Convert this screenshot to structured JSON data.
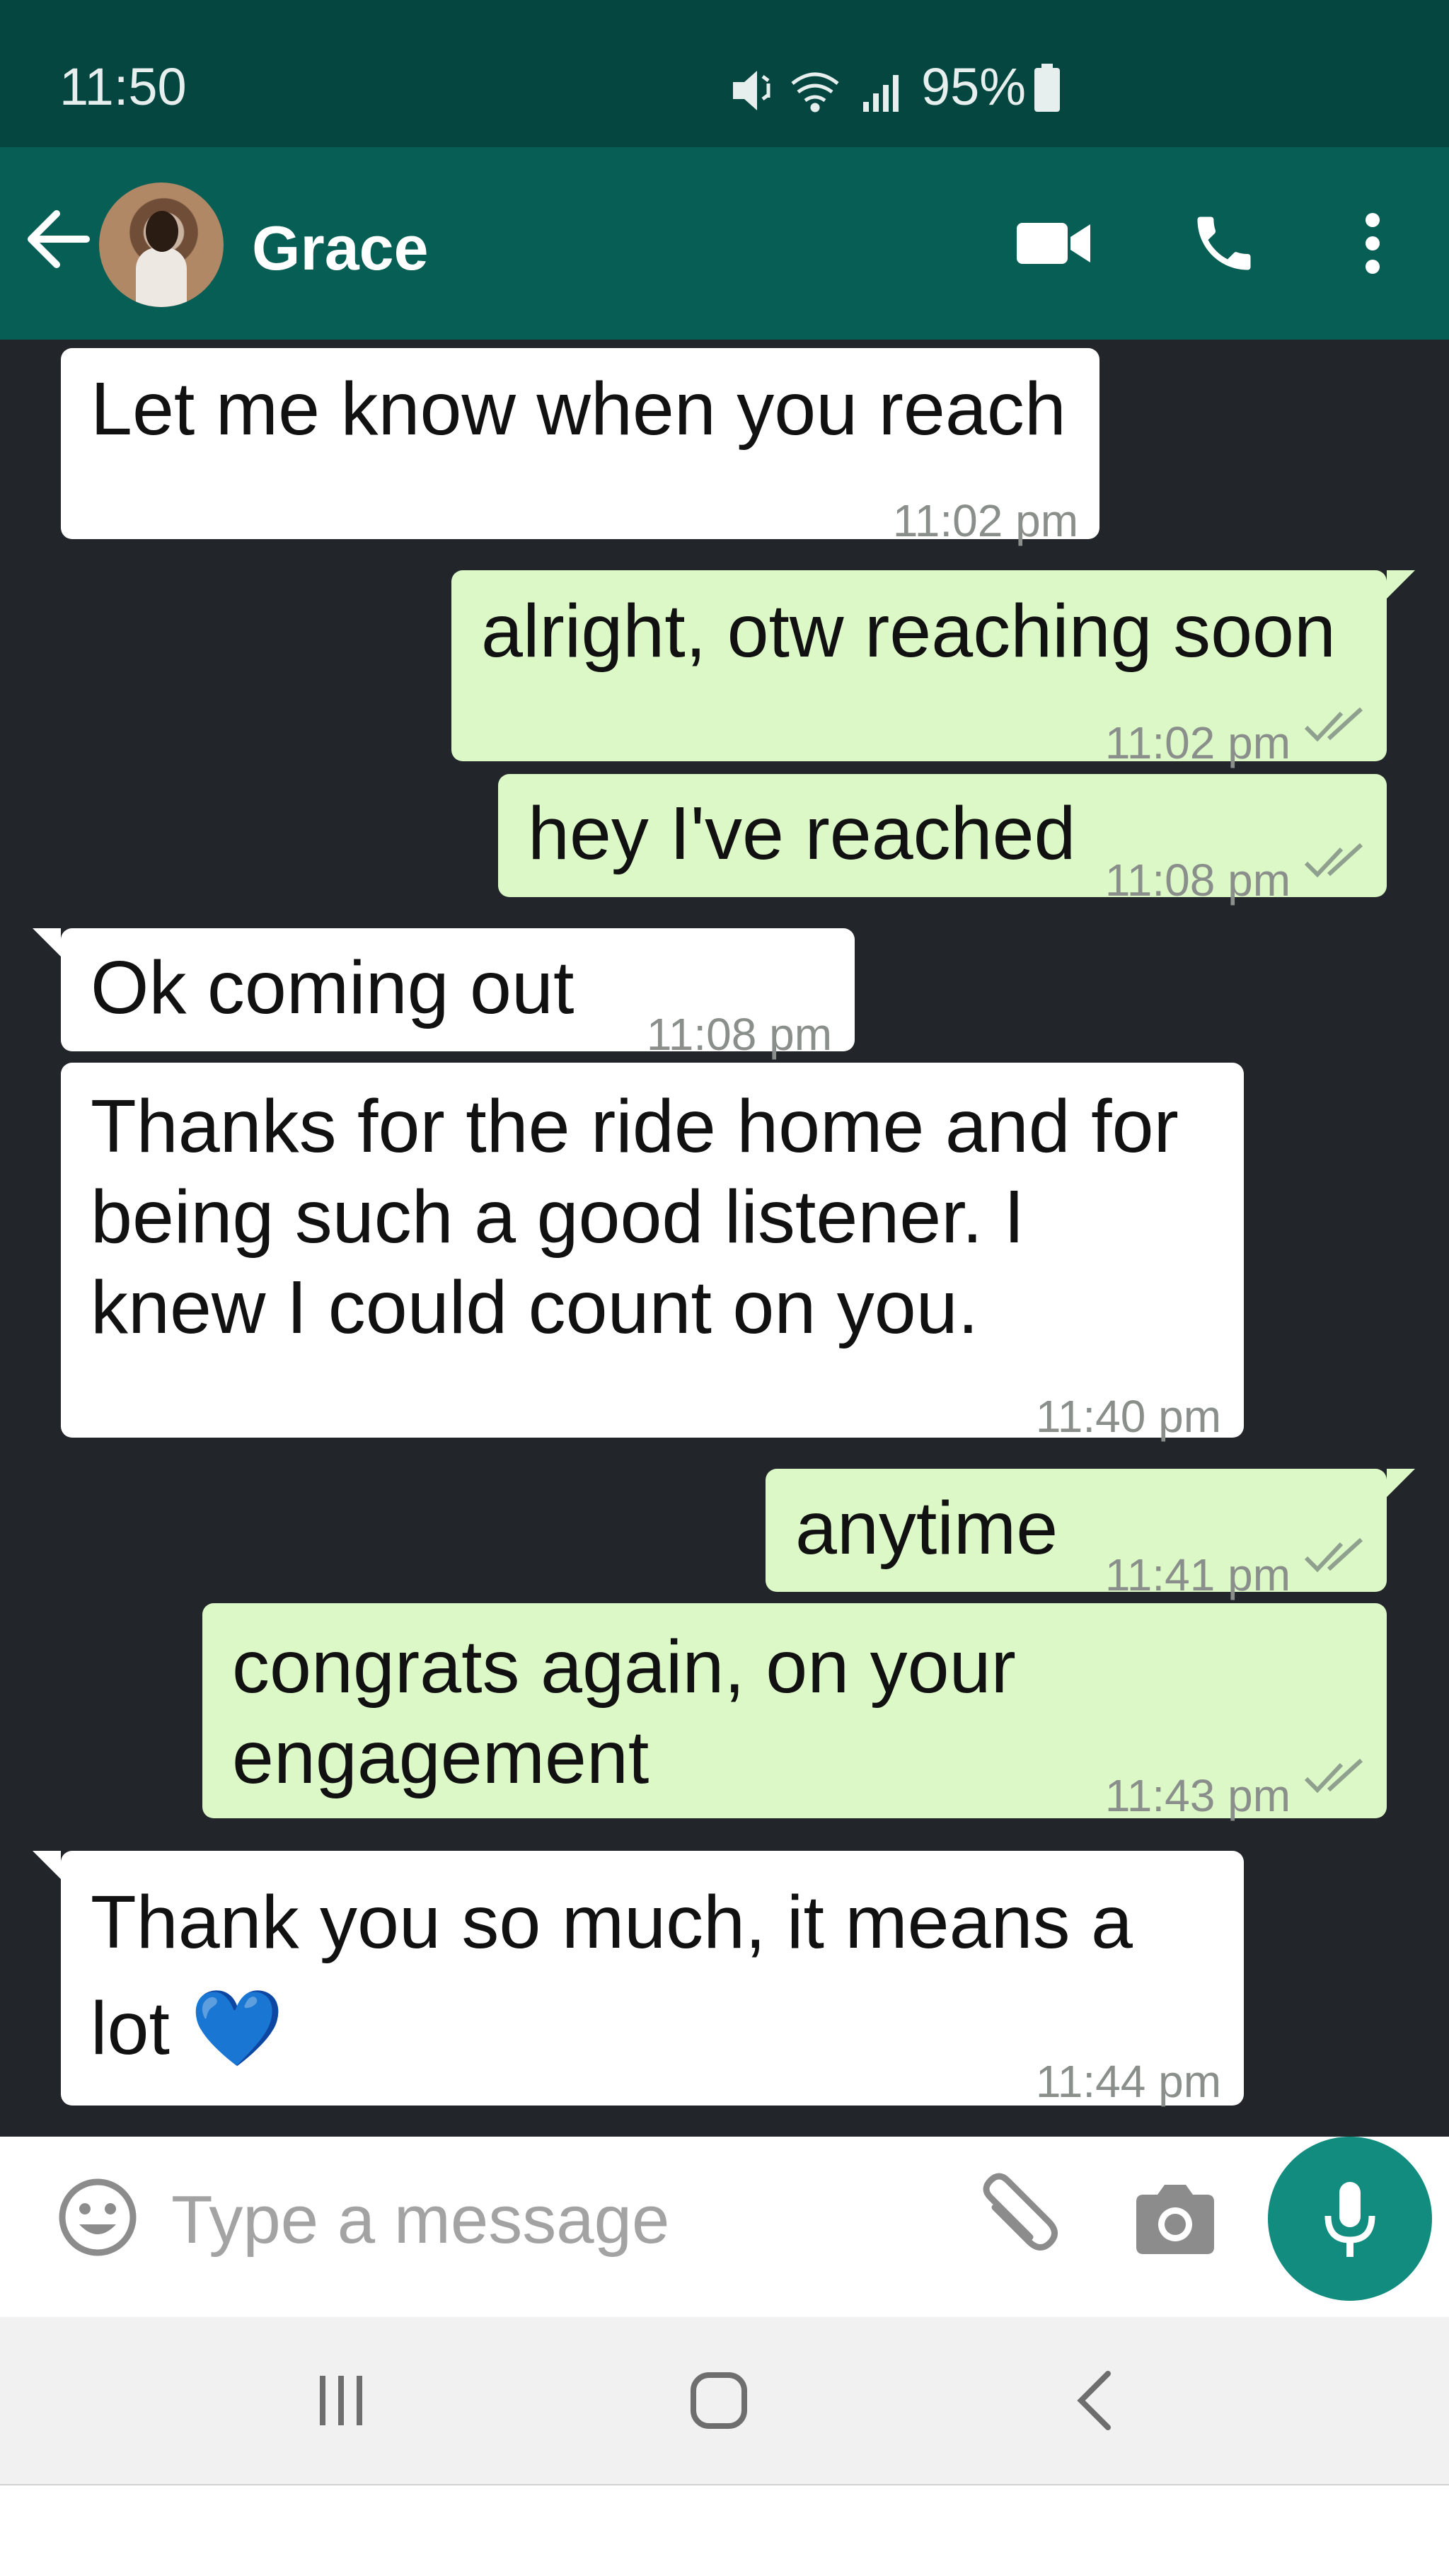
{
  "status_bar": {
    "time": "11:50",
    "battery": "95%",
    "icons": [
      "mute-icon",
      "wifi-icon",
      "signal-icon",
      "battery-icon"
    ]
  },
  "header": {
    "contact_name": "Grace",
    "icons": [
      "back-arrow-icon",
      "video-call-icon",
      "phone-icon",
      "more-vert-icon"
    ]
  },
  "messages": [
    {
      "dir": "in",
      "text": "Let me know when you reach",
      "time": "11:02 pm"
    },
    {
      "dir": "out",
      "text": "alright, otw reaching soon",
      "time": "11:02 pm",
      "status": "delivered"
    },
    {
      "dir": "out",
      "text": "hey I've reached",
      "time": "11:08 pm",
      "status": "delivered"
    },
    {
      "dir": "in",
      "text": "Ok coming out",
      "time": "11:08 pm"
    },
    {
      "dir": "in",
      "text": "Thanks for the ride home and for being such a good listener. I knew I could count on you.",
      "time": "11:40 pm"
    },
    {
      "dir": "out",
      "text": "anytime",
      "time": "11:41 pm",
      "status": "delivered"
    },
    {
      "dir": "out",
      "text": "congrats again, on your engagement",
      "time": "11:43 pm",
      "status": "delivered"
    },
    {
      "dir": "in",
      "text": "Thank you so much, it means a lot 💙",
      "time": "11:44 pm"
    }
  ],
  "composer": {
    "placeholder": "Type a message",
    "value": ""
  },
  "colors": {
    "status_bar": "#054740",
    "header": "#075e54",
    "chat_bg": "#22252a",
    "incoming": "#ffffff",
    "outgoing": "#dcf8c6",
    "accent": "#128c7e"
  }
}
